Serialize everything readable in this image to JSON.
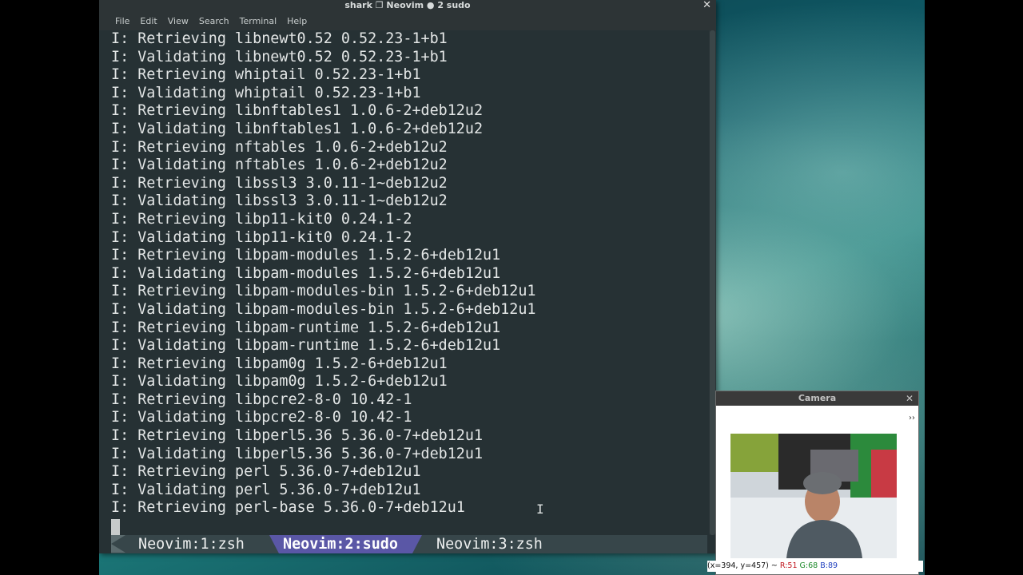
{
  "window": {
    "title": "shark ❐ Neovim ● 2 sudo",
    "close": "✕"
  },
  "menu": [
    "File",
    "Edit",
    "View",
    "Search",
    "Terminal",
    "Help"
  ],
  "terminal_lines": [
    "I: Retrieving libnewt0.52 0.52.23-1+b1",
    "I: Validating libnewt0.52 0.52.23-1+b1",
    "I: Retrieving whiptail 0.52.23-1+b1",
    "I: Validating whiptail 0.52.23-1+b1",
    "I: Retrieving libnftables1 1.0.6-2+deb12u2",
    "I: Validating libnftables1 1.0.6-2+deb12u2",
    "I: Retrieving nftables 1.0.6-2+deb12u2",
    "I: Validating nftables 1.0.6-2+deb12u2",
    "I: Retrieving libssl3 3.0.11-1~deb12u2",
    "I: Validating libssl3 3.0.11-1~deb12u2",
    "I: Retrieving libp11-kit0 0.24.1-2",
    "I: Validating libp11-kit0 0.24.1-2",
    "I: Retrieving libpam-modules 1.5.2-6+deb12u1",
    "I: Validating libpam-modules 1.5.2-6+deb12u1",
    "I: Retrieving libpam-modules-bin 1.5.2-6+deb12u1",
    "I: Validating libpam-modules-bin 1.5.2-6+deb12u1",
    "I: Retrieving libpam-runtime 1.5.2-6+deb12u1",
    "I: Validating libpam-runtime 1.5.2-6+deb12u1",
    "I: Retrieving libpam0g 1.5.2-6+deb12u1",
    "I: Validating libpam0g 1.5.2-6+deb12u1",
    "I: Retrieving libpcre2-8-0 10.42-1",
    "I: Validating libpcre2-8-0 10.42-1",
    "I: Retrieving libperl5.36 5.36.0-7+deb12u1",
    "I: Validating libperl5.36 5.36.0-7+deb12u1",
    "I: Retrieving perl 5.36.0-7+deb12u1",
    "I: Validating perl 5.36.0-7+deb12u1",
    "I: Retrieving perl-base 5.36.0-7+deb12u1"
  ],
  "tmux": {
    "tab1": "Neovim:1:zsh",
    "tab2": "Neovim:2:sudo",
    "tab3": "Neovim:3:zsh",
    "active_color": "#5a57a6"
  },
  "camera": {
    "title": "Camera",
    "close": "✕",
    "more": "››",
    "status_prefix": "(x=394, y=457) ~",
    "r": "R:51",
    "g": "G:68",
    "b": "B:89"
  },
  "icons": {
    "mouse_cursor": "text-cursor-icon"
  }
}
